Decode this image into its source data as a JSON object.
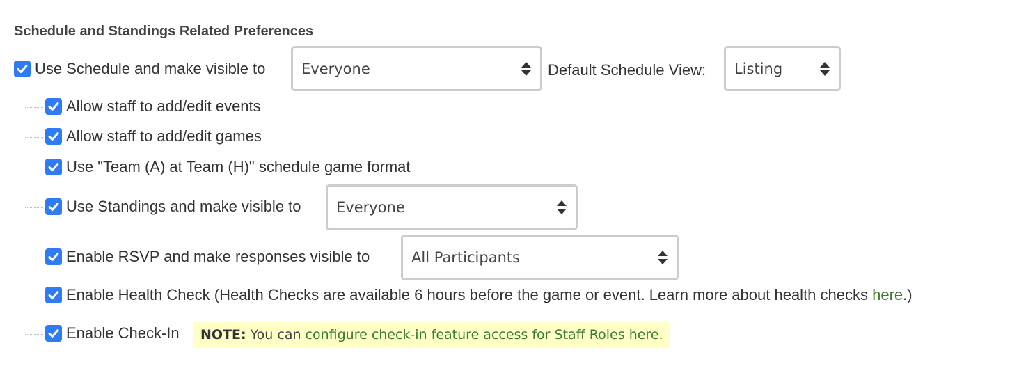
{
  "section": {
    "title": "Schedule and Standings Related Preferences"
  },
  "schedule": {
    "checked": true,
    "label": "Use Schedule and make visible to",
    "visibility_value": "Everyone",
    "default_view_label": "Default Schedule View:",
    "default_view_value": "Listing"
  },
  "options": [
    {
      "checked": true,
      "label": "Allow staff to add/edit events"
    },
    {
      "checked": true,
      "label": "Allow staff to add/edit games"
    },
    {
      "checked": true,
      "label": "Use \"Team (A) at Team (H)\" schedule game format"
    },
    {
      "checked": true,
      "label": "Use Standings and make visible to",
      "select_value": "Everyone"
    },
    {
      "checked": true,
      "label": "Enable RSVP and make responses visible to",
      "select_value": "All Participants"
    },
    {
      "checked": true,
      "label": "Enable Health Check (Health Checks are available 6 hours before the game or event. Learn more about health checks ",
      "link": "here",
      "suffix": ".)"
    },
    {
      "checked": true,
      "label": "Enable Check-In"
    }
  ],
  "checkin_note": {
    "prefix": "NOTE:",
    "text": "You can ",
    "link": "configure check-in feature access for Staff Roles here."
  },
  "colors": {
    "checkbox": "#2f7bf5",
    "link": "#3a7d2c",
    "note_background": "#ffffc6"
  }
}
